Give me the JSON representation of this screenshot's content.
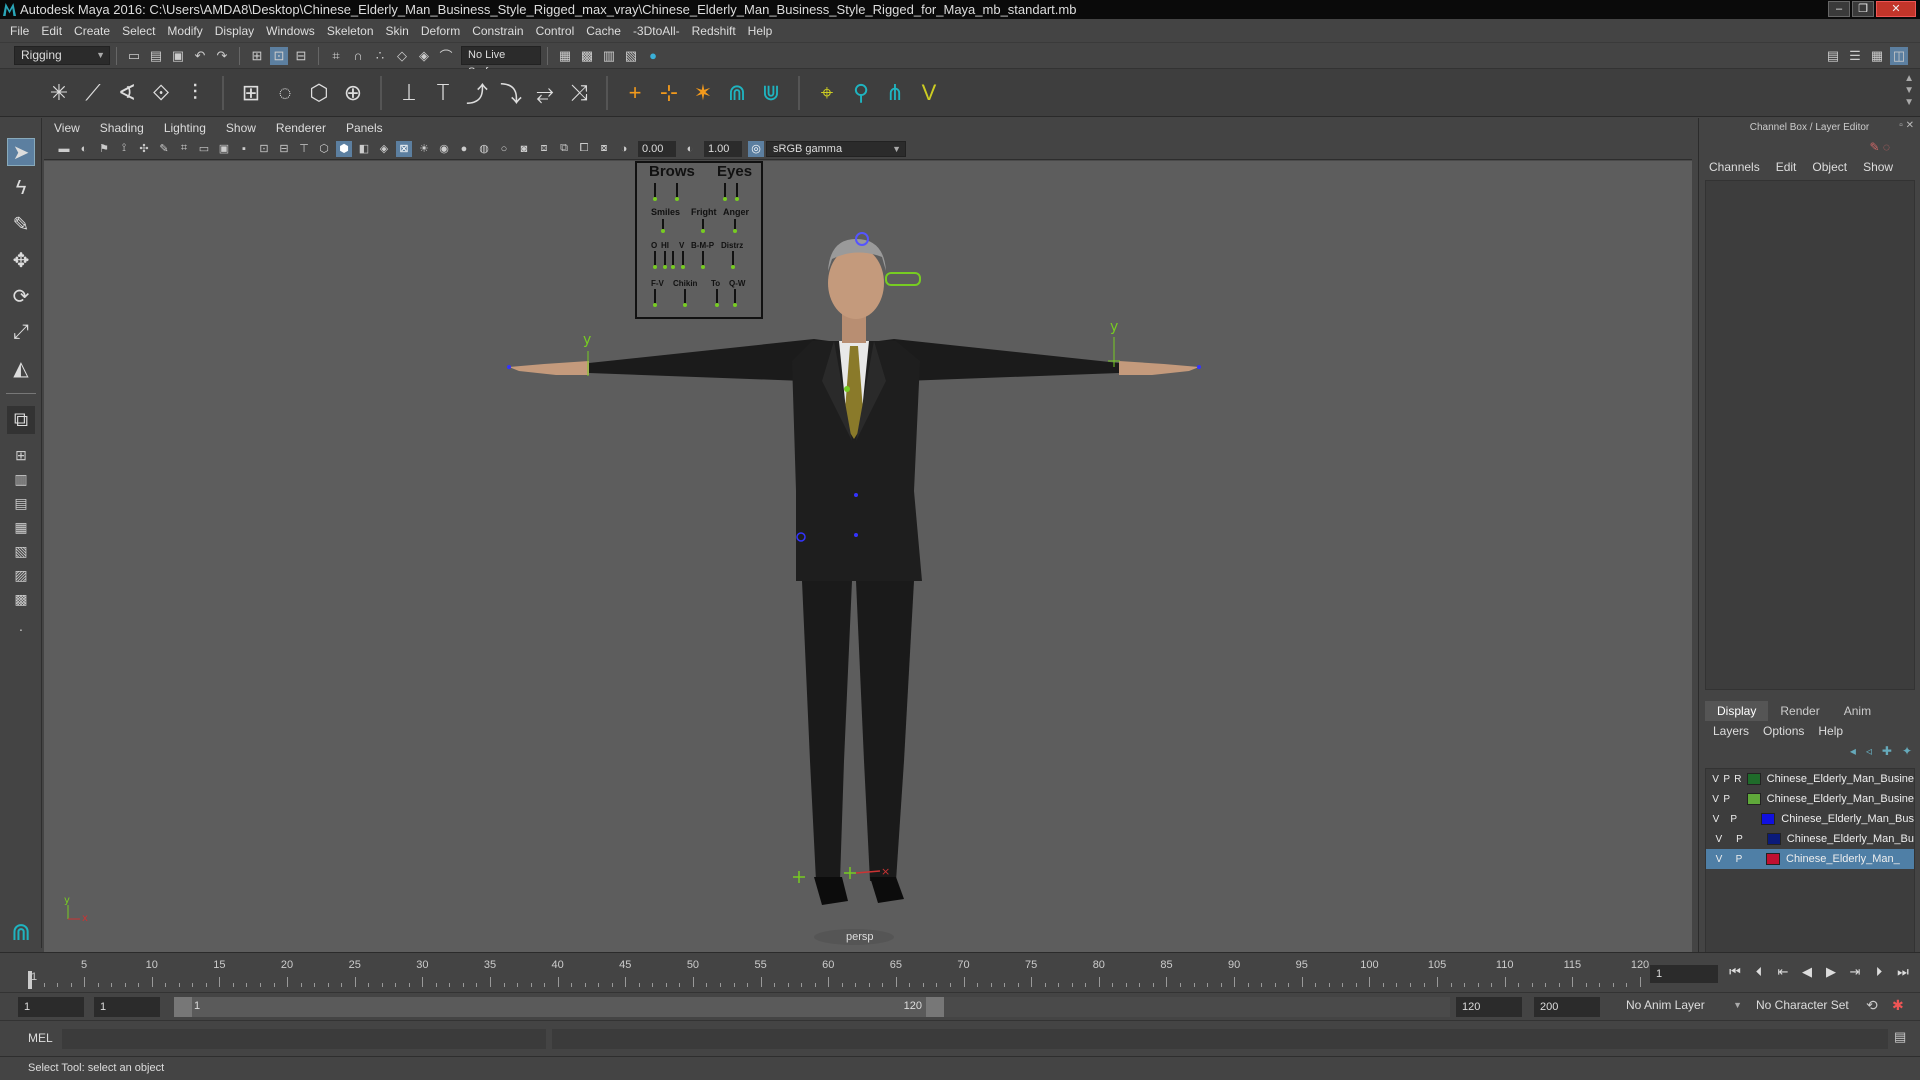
{
  "window": {
    "title": "Autodesk Maya 2016: C:\\Users\\AMDA8\\Desktop\\Chinese_Elderly_Man_Business_Style_Rigged_max_vray\\Chinese_Elderly_Man_Business_Style_Rigged_for_Maya_mb_standart.mb",
    "min": "–",
    "max": "❐",
    "close": "✕"
  },
  "menubar": [
    "File",
    "Edit",
    "Create",
    "Select",
    "Modify",
    "Display",
    "Windows",
    "Skeleton",
    "Skin",
    "Deform",
    "Constrain",
    "Control",
    "Cache",
    "-3DtoAll-",
    "Redshift",
    "Help"
  ],
  "statusline": {
    "mode": "Rigging",
    "live_surface": "No Live Surface"
  },
  "viewport": {
    "menus": [
      "View",
      "Shading",
      "Lighting",
      "Show",
      "Renderer",
      "Panels"
    ],
    "exposure": "0.00",
    "gamma": "1.00",
    "colorspace": "sRGB gamma",
    "camera": "persp"
  },
  "facial_panel": {
    "row1": [
      "Brows",
      "Eyes"
    ],
    "row2": [
      "Smiles",
      "Fright",
      "Anger"
    ],
    "row3": [
      "O",
      "HI",
      "V",
      "B-M-P",
      "Distrz"
    ],
    "row4": [
      "F-V",
      "Chikin",
      "To",
      "Q-W"
    ]
  },
  "channelbox": {
    "title": "Channel Box / Layer Editor",
    "menus": [
      "Channels",
      "Edit",
      "Object",
      "Show"
    ],
    "tabs": [
      "Display",
      "Render",
      "Anim"
    ],
    "layer_menus": [
      "Layers",
      "Options",
      "Help"
    ],
    "layers": [
      {
        "v": "V",
        "p": "P",
        "r": "R",
        "color": "#1f6b2a",
        "name": "Chinese_Elderly_Man_Busine",
        "selected": false
      },
      {
        "v": "V",
        "p": "P",
        "r": "",
        "color": "#5fa83a",
        "name": "Chinese_Elderly_Man_Busine",
        "selected": false
      },
      {
        "v": "V",
        "p": "P",
        "r": "",
        "color": "#1010e0",
        "name": "Chinese_Elderly_Man_Bus",
        "selected": false
      },
      {
        "v": "V",
        "p": "P",
        "r": "",
        "color": "#0a1a7a",
        "name": "Chinese_Elderly_Man_Bu",
        "selected": false
      },
      {
        "v": "V",
        "p": "P",
        "r": "",
        "color": "#c01030",
        "name": "Chinese_Elderly_Man_",
        "selected": true
      }
    ]
  },
  "timeline": {
    "ticks": [
      "1",
      "5",
      "10",
      "15",
      "20",
      "25",
      "30",
      "35",
      "40",
      "45",
      "50",
      "55",
      "60",
      "65",
      "70",
      "75",
      "80",
      "85",
      "90",
      "95",
      "100",
      "105",
      "110",
      "115",
      "120"
    ],
    "current": "1"
  },
  "range": {
    "start": "1",
    "inner_start": "1",
    "slider_start": "1",
    "slider_end": "120",
    "inner_end": "120",
    "end": "200",
    "anim_layer": "No Anim Layer",
    "char_set": "No Character Set"
  },
  "cmd": {
    "lang": "MEL"
  },
  "help": "Select Tool: select an object"
}
